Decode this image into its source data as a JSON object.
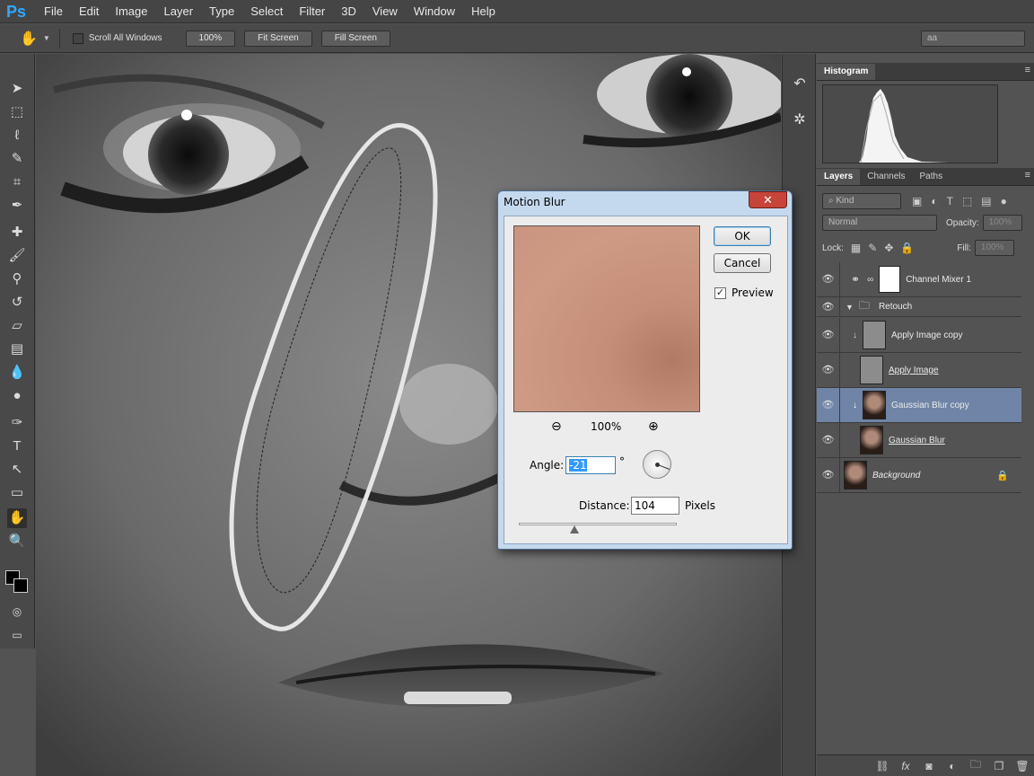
{
  "app": {
    "logo": "Ps"
  },
  "menu": [
    "File",
    "Edit",
    "Image",
    "Layer",
    "Type",
    "Select",
    "Filter",
    "3D",
    "View",
    "Window",
    "Help"
  ],
  "options_bar": {
    "scroll_all_label": "Scroll All Windows",
    "zoom_btn": "100%",
    "fit_btn": "Fit Screen",
    "fill_btn": "Fill Screen",
    "workspace": "aa"
  },
  "histogram_panel": {
    "tab": "Histogram"
  },
  "layers_panel": {
    "tabs": [
      "Layers",
      "Channels",
      "Paths"
    ],
    "kind": "Kind",
    "blend": "Normal",
    "opacity_label": "Opacity:",
    "opacity_value": "100%",
    "lock_label": "Lock:",
    "fill_label": "Fill:",
    "fill_value": "100%",
    "layers": [
      {
        "name": "Channel Mixer 1"
      },
      {
        "name": "Retouch"
      },
      {
        "name": "Apply Image copy"
      },
      {
        "name": "Apply Image"
      },
      {
        "name": "Gaussian Blur copy"
      },
      {
        "name": "Gaussian Blur"
      },
      {
        "name": "Background"
      }
    ]
  },
  "dialog": {
    "title": "Motion Blur",
    "close": "✕",
    "ok": "OK",
    "cancel": "Cancel",
    "preview_label": "Preview",
    "preview_checked": true,
    "zoom": "100%",
    "angle_label": "Angle:",
    "angle_value": "-21",
    "degree": "°",
    "distance_label": "Distance:",
    "distance_value": "104",
    "distance_unit": "Pixels"
  },
  "colors": {
    "accent": "#31a8ff",
    "selected_layer": "#6f84a6",
    "dialog_frame": "#c5d9ee"
  }
}
